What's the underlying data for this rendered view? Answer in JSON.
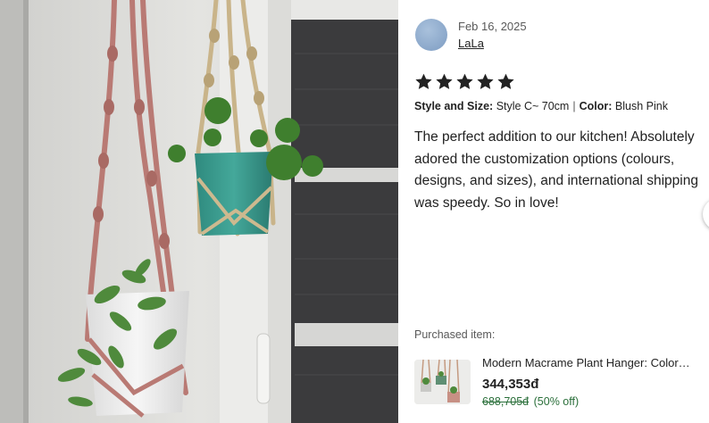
{
  "photo": {
    "alt_icon": "macrame-plant-hanger-photo"
  },
  "review": {
    "date": "Feb 16, 2025",
    "username": "LaLa",
    "rating": 5,
    "style_label": "Style and Size:",
    "style_value": "Style C~ 70cm",
    "color_label": "Color:",
    "color_value": "Blush Pink",
    "separator": "|",
    "text": "The perfect addition to our kitchen! Absolutely adored the customization options (colours, designs, and sizes), and international shipping was speedy. So in love!"
  },
  "purchased": {
    "label": "Purchased item:",
    "title": "Modern Macrame Plant Hanger: Color…",
    "price": "344,353đ",
    "original_price": "688,705đ",
    "discount": "(50% off)"
  },
  "colors": {
    "star": "#222222",
    "avatar": "#8fabd0",
    "sale_green": "#2a6f3a"
  }
}
